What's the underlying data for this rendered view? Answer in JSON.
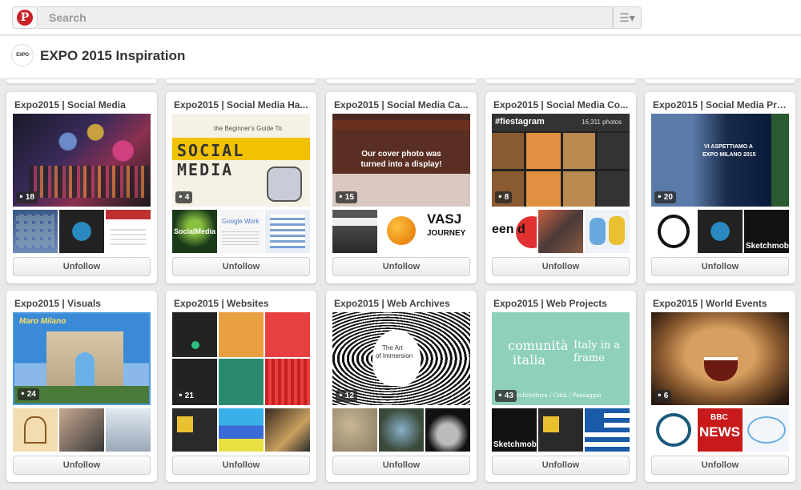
{
  "topbar": {
    "logo_letter": "P",
    "search_placeholder": "Search",
    "menu_icon": "☰▾"
  },
  "board": {
    "avatar_text": "EXPO",
    "title": "EXPO 2015 Inspiration"
  },
  "cards": [
    {
      "title": "Expo2015 | Social Media",
      "pins": "18",
      "button": "Unfollow"
    },
    {
      "title": "Expo2015 | Social Media Ha...",
      "pins": "4",
      "button": "Unfollow"
    },
    {
      "title": "Expo2015 | Social Media Ca...",
      "pins": "15",
      "button": "Unfollow"
    },
    {
      "title": "Expo2015 | Social Media Co...",
      "pins": "8",
      "button": "Unfollow"
    },
    {
      "title": "Expo2015 | Social Media Pro...",
      "pins": "20",
      "button": "Unfollow"
    },
    {
      "title": "Expo2015 | Visuals",
      "pins": "24",
      "button": "Unfollow"
    },
    {
      "title": "Expo2015 | Websites",
      "pins": "21",
      "button": "Unfollow"
    },
    {
      "title": "Expo2015 | Web Archives",
      "pins": "12",
      "button": "Unfollow"
    },
    {
      "title": "Expo2015 | Web Projects",
      "pins": "43",
      "button": "Unfollow"
    },
    {
      "title": "Expo2015 | World Events",
      "pins": "6",
      "button": "Unfollow"
    }
  ],
  "image_text": {
    "c2_big_small": "the Beginner's Guide To",
    "c2_big": "SOCIAL MEDIA",
    "c2_t1": "SocialMedia",
    "c2_t2": "Google Work",
    "c3_big": "Our cover photo was turned into a display!",
    "c3_t3": "VASJ",
    "c3_t3b": "JOURNEY",
    "c4_tag": "#fiestagram",
    "c4_count": "16,311 photos",
    "c4_t1": "een d",
    "c5_big1": "VI ASPETTIAMO A",
    "c5_big2": "EXPO MILANO 2015",
    "c5_t3": "Sketchmob",
    "c6_big": "Maro Milano",
    "c8_big1": "The Art",
    "c8_big2": "of Immersion",
    "c9_big1": "comunità",
    "c9_big2": "italia",
    "c9_big3": "Italy in a frame",
    "c9_big4": "Architettura / Città / Paesaggio",
    "c9_t1": "Sketchmob",
    "c10_t2a": "BBC",
    "c10_t2b": "NEWS"
  },
  "colors": {
    "brand": "#cb2027",
    "background": "#e9e9e9"
  }
}
